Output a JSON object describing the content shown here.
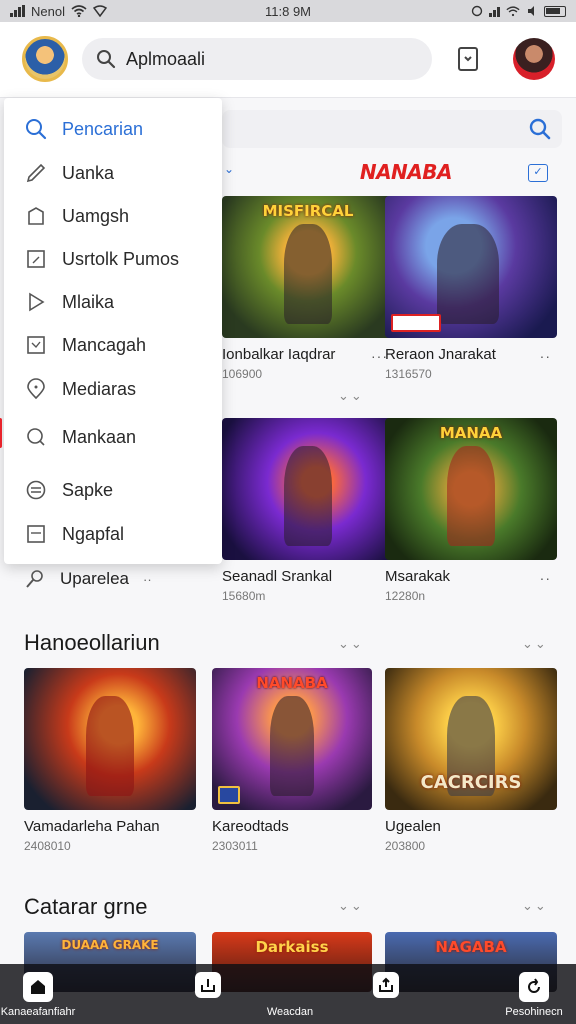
{
  "status_bar": {
    "carrier": "Nenol",
    "time": "11:8 9M"
  },
  "header": {
    "search_label": "Aplmoaali"
  },
  "brand": {
    "badge": "NANABA"
  },
  "drawer": {
    "items": [
      {
        "label": "Pencarian",
        "icon": "search-icon"
      },
      {
        "label": "Uanka",
        "icon": "pencil-icon"
      },
      {
        "label": "Uamgsh",
        "icon": "tag-icon"
      },
      {
        "label": "Usrtolk Pumos",
        "icon": "corner-box-icon"
      },
      {
        "label": "Mlaika",
        "icon": "play-icon"
      },
      {
        "label": "Mancagah",
        "icon": "corner-box-icon"
      },
      {
        "label": "Mediaras",
        "icon": "pin-icon"
      },
      {
        "label": "Mankaan",
        "icon": "tag-circle-icon"
      },
      {
        "label": "Sapke",
        "icon": "lines-circle-icon"
      },
      {
        "label": "Ngapfal",
        "icon": "doc-icon"
      }
    ],
    "below_item": "Uparelea"
  },
  "row1": [
    {
      "title": "Ionbalkar Iaqdrar",
      "meta": "106900",
      "badge": "MISFIRCAL"
    },
    {
      "title": "Reraon Jnarakat",
      "meta": "1316570",
      "badge": ""
    }
  ],
  "row2": [
    {
      "title": "Seanadl Srankal",
      "meta": "15680m",
      "badge": ""
    },
    {
      "title": "Msarakak",
      "meta": "12280n",
      "badge": "MANAA"
    }
  ],
  "sections": [
    {
      "title": "Hanoeollariun",
      "cards": [
        {
          "title": "Vamadarleha Pahan",
          "meta": "2408010",
          "badge": ""
        },
        {
          "title": "Kareodtads",
          "meta": "2303011",
          "badge": "NANABA"
        },
        {
          "title": "Ugealen",
          "meta": "203800",
          "badge": "CACRCIRS"
        }
      ]
    },
    {
      "title": "Catarar grne",
      "cards": [
        {
          "title": "",
          "meta": "",
          "badge": "DUAAA GRAKE"
        },
        {
          "title": "",
          "meta": "",
          "badge": "Darkaiss"
        },
        {
          "title": "",
          "meta": "",
          "badge": "NAGABA"
        }
      ]
    }
  ],
  "bottom_nav": [
    {
      "label": "Kanaeafanfiahr"
    },
    {
      "label": ""
    },
    {
      "label": "Weacdan"
    },
    {
      "label": ""
    },
    {
      "label": "Pesohinecn"
    }
  ],
  "colors": {
    "accent": "#2b6fd6",
    "brand_red": "#e02020"
  }
}
